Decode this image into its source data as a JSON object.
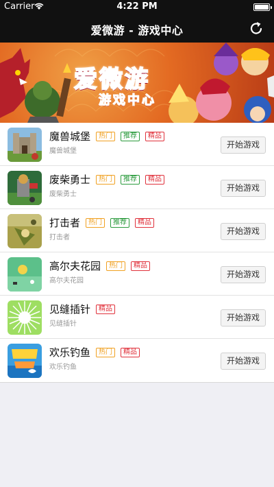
{
  "status_bar": {
    "carrier": "Carrier",
    "time": "4:22 PM"
  },
  "nav": {
    "title": "爱微游 - 游戏中心"
  },
  "banner": {
    "title": "爱微游",
    "subtitle": "游戏中心"
  },
  "tag_labels": {
    "hot": "热门",
    "recommend": "推荐",
    "best": "精品"
  },
  "play_label": "开始游戏",
  "games": [
    {
      "name": "魔兽城堡",
      "desc": "魔兽城堡",
      "tags": [
        "hot",
        "recommend",
        "best"
      ],
      "icon": "castle-game-icon"
    },
    {
      "name": "废柴勇士",
      "desc": "废柴勇士",
      "tags": [
        "hot",
        "recommend",
        "best"
      ],
      "icon": "warrior-game-icon"
    },
    {
      "name": "打击者",
      "desc": "打击者",
      "tags": [
        "hot",
        "recommend",
        "best"
      ],
      "icon": "striker-game-icon"
    },
    {
      "name": "高尔夫花园",
      "desc": "高尔夫花园",
      "tags": [
        "hot",
        "best"
      ],
      "icon": "golf-game-icon"
    },
    {
      "name": "见缝插针",
      "desc": "见缝插针",
      "tags": [
        "best"
      ],
      "icon": "pin-game-icon"
    },
    {
      "name": "欢乐钓鱼",
      "desc": "欢乐钓鱼",
      "tags": [
        "hot",
        "best"
      ],
      "icon": "fishing-game-icon"
    }
  ],
  "colors": {
    "nav_bg": "#111111",
    "hot": "#f0a020",
    "recommend": "#2a9a3c",
    "best": "#e0303a",
    "banner_title": "#ff4d8d"
  }
}
